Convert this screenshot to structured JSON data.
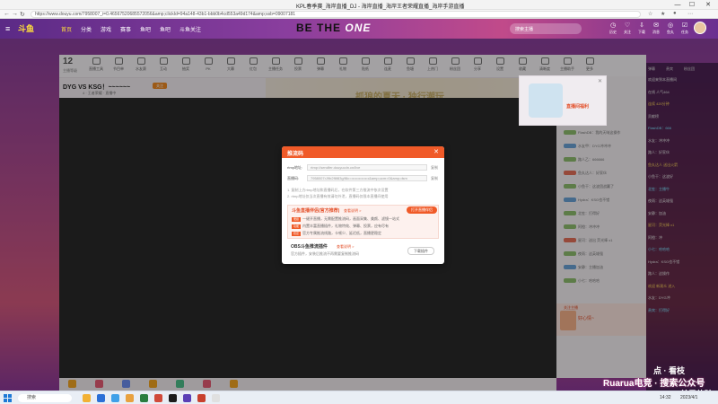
{
  "browser": {
    "window_title": "KPL春季赛_海岸直播_DJ - 海岸直播_海岸王者荣耀直播_海岸手游直播",
    "url": "https://www.douyu.com/7958007_i=0.46567520685572056&amp;clickId=94a148-43b1-bbb0b4cd553a49d174&amp;ssb=09007181",
    "tab_buttons": [
      "—",
      "☐",
      "✕"
    ]
  },
  "site": {
    "nav": [
      "首页",
      "分类",
      "游戏",
      "赛事",
      "鱼吧",
      "鱼吧",
      "斗鱼关注"
    ],
    "banner_main": "BE THE",
    "banner_accent": "ONE",
    "search_placeholder": "搜索主播",
    "top_icons": [
      "历史",
      "关注",
      "下载",
      "消息",
      "鱼丸",
      "任务"
    ]
  },
  "room": {
    "level": "12",
    "level_sub": "主播等级",
    "tools": [
      "直播工具",
      "节目单",
      "水友赛",
      "互动",
      "抽奖",
      "PK",
      "大幕",
      "红包",
      "主播任务",
      "投票",
      "弹幕",
      "礼物",
      "贴纸",
      "连麦",
      "鱼塘",
      "上热门",
      "粉丝团",
      "分享",
      "设置",
      "收藏",
      "清晰度",
      "主播助手",
      "更多"
    ],
    "title": "DYG VS KSG！~~~~~~",
    "follow": "关注",
    "info": "4 · 王者荣耀 · 直播中",
    "art_text": "抓狼的夏天 · 独行潮玩"
  },
  "modal": {
    "title": "推流码",
    "rtmp_label": "rtmp地址:",
    "rtmp_value": "rtmp://sendfer.douyucdn.cn/live",
    "key_label": "直播码:",
    "key_value": "7958007rJ9b2f6f83g/f8c=••••••••••••••&amp;ucm=0&amp;dsm",
    "copy": "复制",
    "tip1": "1. 复制上方rtmp地址和直播码后，在软件第三方推流中依次设置",
    "tip2": "2. rtmp地址仅当次直播有效请勿外泄，直播码仅限本直播间使用",
    "panel_title": "斗鱼直播伴侣(官方推荐)",
    "panel_link": "查看说明 >",
    "panel_btn": "打开直播伴侣",
    "panel_rows": [
      {
        "tag": "便捷",
        "text": "一键开直播，无需配置推流码，画面采集、美颜、滤镜一站式"
      },
      {
        "tag": "功能",
        "text": "内置丰富直播插件，礼物特效、弹幕、投票，应有尽有"
      },
      {
        "tag": "稳定",
        "text": "官方专属推流线路，卡顿少、延迟低，直播更稳定"
      }
    ],
    "obs_title": "OBS斗鱼推流插件",
    "obs_link": "查看说明 >",
    "obs_desc": "官方插件，安装后推流不再需要复制推流码",
    "obs_btn": "下载插件",
    "close": "✕"
  },
  "promo": {
    "text": "直播间福利",
    "close": "✕"
  },
  "chat": {
    "lines": [
      {
        "badge": "g",
        "text": "FlashDB：我的天呐这操作"
      },
      {
        "badge": "b",
        "text": "水友甲：DYG冲冲冲"
      },
      {
        "badge": "g",
        "text": "路人乙：666666"
      },
      {
        "badge": "r",
        "text": "鱼丸达人：好家伙"
      },
      {
        "badge": "g",
        "text": "小鱼干：这波团战赢了"
      },
      {
        "badge": "b",
        "text": "Hydra：KSG也不错"
      },
      {
        "badge": "g",
        "text": "北笙：打得好"
      },
      {
        "badge": "g",
        "text": "阿橙：冲冲冲"
      },
      {
        "badge": "r",
        "text": "星河：送出 荧光棒 x1"
      },
      {
        "badge": "g",
        "text": "夜雨：这英雄强"
      },
      {
        "badge": "b",
        "text": "安静：主播加油"
      },
      {
        "badge": "g",
        "text": "小七：哈哈哈"
      }
    ],
    "notice_title": "关注主播",
    "notice_text": "好心情~"
  },
  "darkchat": {
    "tabs": [
      "弹幕",
      "贵宾",
      "粉丝团"
    ],
    "lines": [
      {
        "style": "",
        "text": "欢迎来到本直播间"
      },
      {
        "style": "",
        "text": "在线 人气464"
      },
      {
        "style": "hl",
        "text": "连续 420分钟"
      },
      {
        "style": "",
        "text": "贡献榜"
      },
      {
        "style": "cy",
        "text": "FlashDB：666"
      },
      {
        "style": "",
        "text": "水友：冲冲冲"
      },
      {
        "style": "",
        "text": "路人：好家伙"
      },
      {
        "style": "hl",
        "text": "鱼丸达人 送出火箭"
      },
      {
        "style": "",
        "text": "小鱼干：这波好"
      },
      {
        "style": "cy",
        "text": "北笙：主播牛"
      },
      {
        "style": "",
        "text": "夜雨：这英雄强"
      },
      {
        "style": "",
        "text": "安静：加油"
      },
      {
        "style": "hl",
        "text": "星河：荧光棒 x1"
      },
      {
        "style": "",
        "text": "阿橙：冲"
      },
      {
        "style": "cy",
        "text": "小七：哈哈哈"
      },
      {
        "style": "",
        "text": "Hydra：KSG也不错"
      },
      {
        "style": "",
        "text": "路人：这操作"
      },
      {
        "style": "hl",
        "text": "欢迎 新观众 进入"
      },
      {
        "style": "",
        "text": "水友：DYG冲"
      },
      {
        "style": "cy",
        "text": "贵宾：打得好"
      }
    ]
  },
  "watermark": {
    "line1": "点 · 看枝",
    "line2": "Ruarua电竞 · 搜索公众号",
    "line3": "9 · 9首局体验"
  },
  "taskbar": {
    "search": "搜索",
    "time": "14:32",
    "date": "2023/4/1"
  }
}
